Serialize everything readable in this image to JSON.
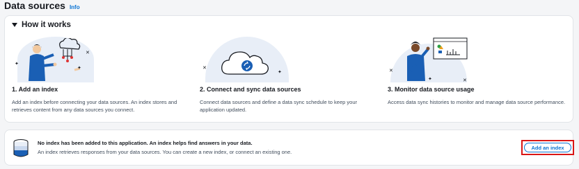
{
  "page": {
    "title": "Data sources",
    "info": "Info"
  },
  "how_it_works": {
    "title": "How it works",
    "steps": [
      {
        "title": "1. Add an index",
        "description": "Add an index before connecting your data sources. An index stores and retrieves content from any data sources you connect."
      },
      {
        "title": "2. Connect and sync data sources",
        "description": "Connect data sources and define a data sync schedule to keep your application updated."
      },
      {
        "title": "3. Monitor data source usage",
        "description": "Access data sync histories to monitor and manage data source performance."
      }
    ]
  },
  "empty_state": {
    "title": "No index has been added to this application. An index helps find answers in your data.",
    "description": "An index retrieves responses from your data sources. You can create a new index, or connect an existing one.",
    "button": "Add an index"
  },
  "colors": {
    "accent": "#0972d3",
    "highlight": "#d91515",
    "blob": "#e8eef7",
    "figure": "#1a5fb4"
  }
}
